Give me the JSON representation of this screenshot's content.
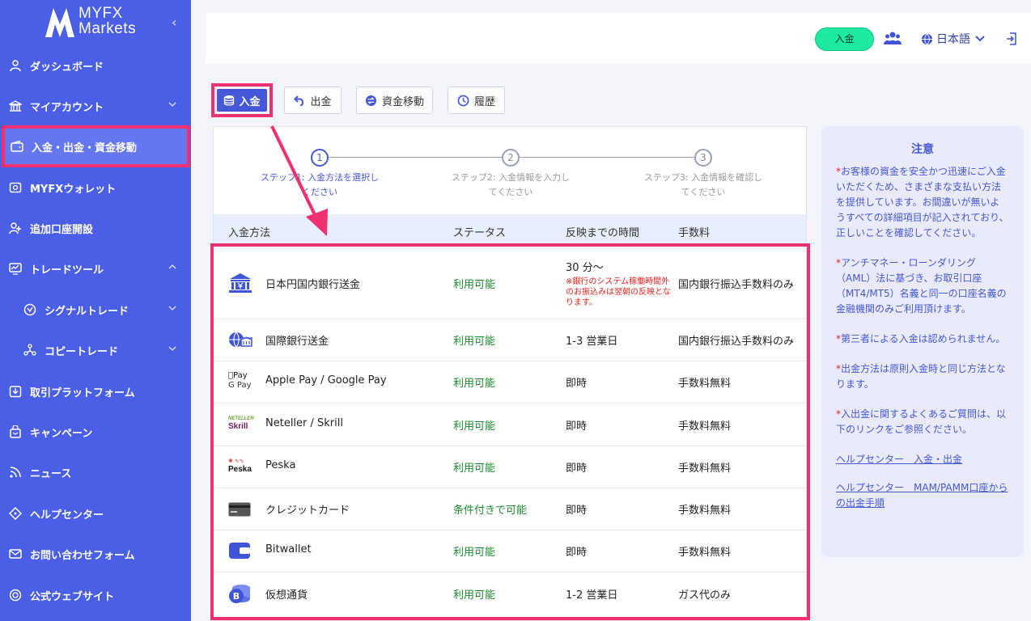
{
  "sidebar": {
    "brand_line1": "MYFX",
    "brand_line2": "Markets",
    "collapse": "‹",
    "items": [
      {
        "label": "ダッシュボード",
        "icon": "user-icon"
      },
      {
        "label": "マイアカウント",
        "icon": "bank-icon"
      },
      {
        "label": "入金・出金・資金移動",
        "icon": "wallet-icon"
      },
      {
        "label": "MYFXウォレット",
        "icon": "wallet-icon"
      },
      {
        "label": "追加口座開設",
        "icon": "add-user-icon"
      },
      {
        "label": "トレードツール",
        "icon": "chart-icon"
      },
      {
        "label": "シグナルトレード",
        "icon": "signal-icon"
      },
      {
        "label": "コピートレード",
        "icon": "copy-icon"
      },
      {
        "label": "取引プラットフォーム",
        "icon": "download-icon"
      },
      {
        "label": "キャンペーン",
        "icon": "gift-icon"
      },
      {
        "label": "ニュース",
        "icon": "rss-icon"
      },
      {
        "label": "ヘルプセンター",
        "icon": "help-icon"
      },
      {
        "label": "お問い合わせフォーム",
        "icon": "mail-icon"
      },
      {
        "label": "公式ウェブサイト",
        "icon": "globe-icon"
      }
    ]
  },
  "topbar": {
    "deposit_button": "入金",
    "language": "日本語"
  },
  "tabs": {
    "deposit": "入金",
    "withdraw": "出金",
    "transfer": "資金移動",
    "history": "履歴"
  },
  "stepper": [
    {
      "num": "1",
      "line1": "ステップ1: 入金方法を選択し",
      "line2": "ください"
    },
    {
      "num": "2",
      "line1": "ステップ2: 入金情報を入力し",
      "line2": "てください"
    },
    {
      "num": "3",
      "line1": "ステップ3: 入金情報を確認し",
      "line2": "てください"
    }
  ],
  "table": {
    "headers": {
      "method": "入金方法",
      "status": "ステータス",
      "time": "反映までの時間",
      "fee": "手数料"
    },
    "rows": [
      {
        "name": "日本円国内銀行送金",
        "status": "利用可能",
        "time": "30 分〜",
        "note": "※銀行のシステム稼働時間外のお振込みは翌朝の反映となります。",
        "fee": "国内銀行振込手数料のみ",
        "icon": "bank-yen-icon"
      },
      {
        "name": "国際銀行送金",
        "status": "利用可能",
        "time": "1-3 営業日",
        "fee": "国内銀行振込手数料のみ",
        "icon": "globe-bank-icon"
      },
      {
        "name": "Apple Pay / Google Pay",
        "status": "利用可能",
        "time": "即時",
        "fee": "手数料無料",
        "icon": "applepay-googlepay-icon"
      },
      {
        "name": "Neteller / Skrill",
        "status": "利用可能",
        "time": "即時",
        "fee": "手数料無料",
        "icon": "neteller-skrill-icon"
      },
      {
        "name": "Peska",
        "status": "利用可能",
        "time": "即時",
        "fee": "手数料無料",
        "icon": "peska-icon"
      },
      {
        "name": "クレジットカード",
        "status": "条件付きで可能",
        "time": "即時",
        "fee": "手数料無料",
        "icon": "credit-card-icon"
      },
      {
        "name": "Bitwallet",
        "status": "利用可能",
        "time": "即時",
        "fee": "手数料無料",
        "icon": "bitwallet-icon"
      },
      {
        "name": "仮想通貨",
        "status": "利用可能",
        "time": "1-2 営業日",
        "fee": "ガス代のみ",
        "icon": "crypto-icon"
      }
    ],
    "logo_text": {
      "applepay": "Pay",
      "googlepay": "G Pay",
      "neteller": "NETELLER",
      "skrill": "Skrill",
      "peska": "Peska"
    }
  },
  "notice": {
    "title": "注意",
    "p1": "お客様の資金を安全かつ迅速にご入金いただくため、さまざまな支払い方法を提供しています。お間違いが無いようすべての詳細項目が記入されており、正しいことを確認してください。",
    "p2": "アンチマネー・ローンダリング（AML）法に基づき、お取引口座（MT4/MT5）名義と同一の口座名義の金融機関のみご利用頂けます。",
    "p3": "第三者による入金は認められません。",
    "p4": "出金方法は原則入金時と同じ方法となります。",
    "p5": "入出金に関するよくあるご質問は、以下のリンクをご参照ください。",
    "link1": "ヘルプセンター　入金・出金",
    "link2": "ヘルプセンター　MAM/PAMM口座からの出金手順",
    "star": "*"
  },
  "colors": {
    "sidebar": "#4a5ee6",
    "accent": "#4458d8",
    "highlight": "#f2306f",
    "available": "#1b8a2e"
  }
}
